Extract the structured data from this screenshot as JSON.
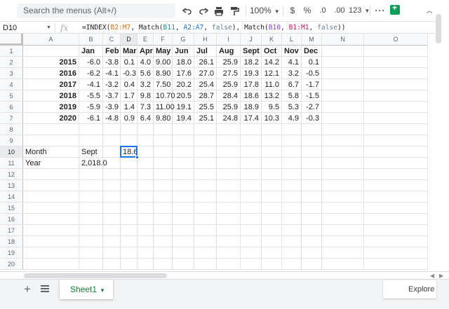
{
  "toolbar": {
    "search_placeholder": "Search the menus (Alt+/)",
    "zoom": "100%",
    "currency": "$",
    "percent": "%",
    "decrease_decimal": ".0",
    "increase_decimal": ".00",
    "number_format": "123"
  },
  "formula_bar": {
    "cell_ref": "D10",
    "fx": "fx",
    "formula_parts": [
      {
        "text": "=INDEX(",
        "color": "default"
      },
      {
        "text": "B2:M7",
        "color": "orange"
      },
      {
        "text": ", Match(",
        "color": "default"
      },
      {
        "text": "B11",
        "color": "teal"
      },
      {
        "text": ", ",
        "color": "default"
      },
      {
        "text": "A2:A7",
        "color": "blue"
      },
      {
        "text": ", ",
        "color": "default"
      },
      {
        "text": "false",
        "color": "gray"
      },
      {
        "text": "), Match(",
        "color": "default"
      },
      {
        "text": "B10",
        "color": "purple"
      },
      {
        "text": ", ",
        "color": "default"
      },
      {
        "text": "B1:M1",
        "color": "pink"
      },
      {
        "text": ", ",
        "color": "default"
      },
      {
        "text": "false",
        "color": "gray"
      },
      {
        "text": "))",
        "color": "default"
      }
    ]
  },
  "columns": [
    "A",
    "B",
    "C",
    "D",
    "E",
    "F",
    "G",
    "H",
    "I",
    "J",
    "K",
    "L",
    "M",
    "N",
    "O"
  ],
  "rows": [
    "1",
    "2",
    "3",
    "4",
    "5",
    "6",
    "7",
    "8",
    "9",
    "10",
    "11",
    "12",
    "13",
    "14",
    "15",
    "16",
    "17",
    "18",
    "19",
    "20"
  ],
  "selected": {
    "column": "D",
    "row": "10"
  },
  "cells": [
    {
      "ref": "B1",
      "text": "Jan",
      "bold": true
    },
    {
      "ref": "C1",
      "text": "Feb",
      "bold": true
    },
    {
      "ref": "D1",
      "text": "Mar",
      "bold": true
    },
    {
      "ref": "E1",
      "text": "Apr",
      "bold": true
    },
    {
      "ref": "F1",
      "text": "May",
      "bold": true
    },
    {
      "ref": "G1",
      "text": "Jun",
      "bold": true
    },
    {
      "ref": "H1",
      "text": "Jul",
      "bold": true
    },
    {
      "ref": "I1",
      "text": "Aug",
      "bold": true
    },
    {
      "ref": "J1",
      "text": "Sept",
      "bold": true
    },
    {
      "ref": "K1",
      "text": "Oct",
      "bold": true
    },
    {
      "ref": "L1",
      "text": "Nov",
      "bold": true
    },
    {
      "ref": "M1",
      "text": "Dec",
      "bold": true
    },
    {
      "ref": "A2",
      "text": "2015",
      "bold": true,
      "num": true
    },
    {
      "ref": "B2",
      "text": "-6.0",
      "num": true
    },
    {
      "ref": "C2",
      "text": "-3.8",
      "num": true
    },
    {
      "ref": "D2",
      "text": "0.1",
      "num": true
    },
    {
      "ref": "E2",
      "text": "4.0",
      "num": true
    },
    {
      "ref": "F2",
      "text": "9.00",
      "num": true
    },
    {
      "ref": "G2",
      "text": "18.0",
      "num": true
    },
    {
      "ref": "H2",
      "text": "26.1",
      "num": true
    },
    {
      "ref": "I2",
      "text": "25.9",
      "num": true
    },
    {
      "ref": "J2",
      "text": "18.2",
      "num": true
    },
    {
      "ref": "K2",
      "text": "14.2",
      "num": true
    },
    {
      "ref": "L2",
      "text": "4.1",
      "num": true
    },
    {
      "ref": "M2",
      "text": "0.1",
      "num": true
    },
    {
      "ref": "A3",
      "text": "2016",
      "bold": true,
      "num": true
    },
    {
      "ref": "B3",
      "text": "-6.2",
      "num": true
    },
    {
      "ref": "C3",
      "text": "-4.1",
      "num": true
    },
    {
      "ref": "D3",
      "text": "-0.3",
      "num": true
    },
    {
      "ref": "E3",
      "text": "5.6",
      "num": true
    },
    {
      "ref": "F3",
      "text": "8.90",
      "num": true
    },
    {
      "ref": "G3",
      "text": "17.6",
      "num": true
    },
    {
      "ref": "H3",
      "text": "27.0",
      "num": true
    },
    {
      "ref": "I3",
      "text": "27.5",
      "num": true
    },
    {
      "ref": "J3",
      "text": "19.3",
      "num": true
    },
    {
      "ref": "K3",
      "text": "12.1",
      "num": true
    },
    {
      "ref": "L3",
      "text": "3.2",
      "num": true
    },
    {
      "ref": "M3",
      "text": "-0.5",
      "num": true
    },
    {
      "ref": "A4",
      "text": "2017",
      "bold": true,
      "num": true
    },
    {
      "ref": "B4",
      "text": "-4.1",
      "num": true
    },
    {
      "ref": "C4",
      "text": "-3.2",
      "num": true
    },
    {
      "ref": "D4",
      "text": "0.4",
      "num": true
    },
    {
      "ref": "E4",
      "text": "3.2",
      "num": true
    },
    {
      "ref": "F4",
      "text": "7.50",
      "num": true
    },
    {
      "ref": "G4",
      "text": "20.2",
      "num": true
    },
    {
      "ref": "H4",
      "text": "25.4",
      "num": true
    },
    {
      "ref": "I4",
      "text": "25.9",
      "num": true
    },
    {
      "ref": "J4",
      "text": "17.8",
      "num": true
    },
    {
      "ref": "K4",
      "text": "11.0",
      "num": true
    },
    {
      "ref": "L4",
      "text": "6.7",
      "num": true
    },
    {
      "ref": "M4",
      "text": "-1.7",
      "num": true
    },
    {
      "ref": "A5",
      "text": "2018",
      "bold": true,
      "num": true
    },
    {
      "ref": "B5",
      "text": "-5.5",
      "num": true
    },
    {
      "ref": "C5",
      "text": "-3.7",
      "num": true
    },
    {
      "ref": "D5",
      "text": "1.7",
      "num": true
    },
    {
      "ref": "E5",
      "text": "9.8",
      "num": true
    },
    {
      "ref": "F5",
      "text": "10.70",
      "num": true
    },
    {
      "ref": "G5",
      "text": "20.5",
      "num": true
    },
    {
      "ref": "H5",
      "text": "28.7",
      "num": true
    },
    {
      "ref": "I5",
      "text": "28.4",
      "num": true
    },
    {
      "ref": "J5",
      "text": "18.6",
      "num": true
    },
    {
      "ref": "K5",
      "text": "13.2",
      "num": true
    },
    {
      "ref": "L5",
      "text": "5.8",
      "num": true
    },
    {
      "ref": "M5",
      "text": "-1.5",
      "num": true
    },
    {
      "ref": "A6",
      "text": "2019",
      "bold": true,
      "num": true
    },
    {
      "ref": "B6",
      "text": "-5.9",
      "num": true
    },
    {
      "ref": "C6",
      "text": "-3.9",
      "num": true
    },
    {
      "ref": "D6",
      "text": "1.4",
      "num": true
    },
    {
      "ref": "E6",
      "text": "7.3",
      "num": true
    },
    {
      "ref": "F6",
      "text": "11.00",
      "num": true
    },
    {
      "ref": "G6",
      "text": "19.1",
      "num": true
    },
    {
      "ref": "H6",
      "text": "25.5",
      "num": true
    },
    {
      "ref": "I6",
      "text": "25.9",
      "num": true
    },
    {
      "ref": "J6",
      "text": "18.9",
      "num": true
    },
    {
      "ref": "K6",
      "text": "9.5",
      "num": true
    },
    {
      "ref": "L6",
      "text": "5.3",
      "num": true
    },
    {
      "ref": "M6",
      "text": "-2.7",
      "num": true
    },
    {
      "ref": "A7",
      "text": "2020",
      "bold": true,
      "num": true
    },
    {
      "ref": "B7",
      "text": "-6.1",
      "num": true
    },
    {
      "ref": "C7",
      "text": "-4.8",
      "num": true
    },
    {
      "ref": "D7",
      "text": "0.9",
      "num": true
    },
    {
      "ref": "E7",
      "text": "6.4",
      "num": true
    },
    {
      "ref": "F7",
      "text": "9.80",
      "num": true
    },
    {
      "ref": "G7",
      "text": "19.4",
      "num": true
    },
    {
      "ref": "H7",
      "text": "25.1",
      "num": true
    },
    {
      "ref": "I7",
      "text": "24.8",
      "num": true
    },
    {
      "ref": "J7",
      "text": "17.4",
      "num": true
    },
    {
      "ref": "K7",
      "text": "10.3",
      "num": true
    },
    {
      "ref": "L7",
      "text": "4.9",
      "num": true
    },
    {
      "ref": "M7",
      "text": "-0.3",
      "num": true
    },
    {
      "ref": "A10",
      "text": "Month"
    },
    {
      "ref": "B10",
      "text": "Sept"
    },
    {
      "ref": "D10",
      "text": "18.6",
      "num": true
    },
    {
      "ref": "A11",
      "text": "Year"
    },
    {
      "ref": "B11",
      "text": "2,018.0",
      "num": true
    }
  ],
  "bottom_bar": {
    "sheet_name": "Sheet1",
    "explore_label": "Explore"
  },
  "colors": {
    "accent_blue": "#1a73e8",
    "sheet_green": "#188038",
    "explore_green": "#0f9d58"
  }
}
